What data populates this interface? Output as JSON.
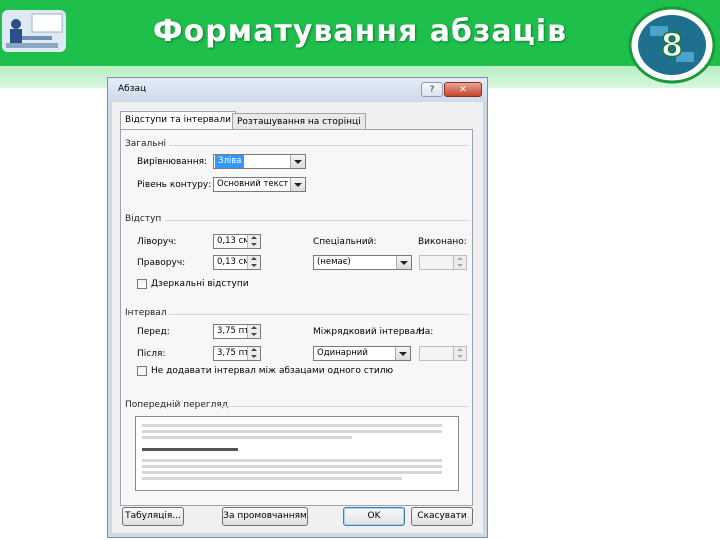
{
  "slide": {
    "title": "Форматування абзаців",
    "badge_number": "8"
  },
  "dialog": {
    "title": "Абзац",
    "help_label": "?",
    "close_label": "✕",
    "tabs": [
      {
        "label": "Відступи та інтервали",
        "active": true
      },
      {
        "label": "Розташування на сторінці",
        "active": false
      }
    ],
    "general": {
      "heading": "Загальні",
      "alignment_label": "Вирівнювання:",
      "alignment_value": "Зліва",
      "outline_label": "Рівень контуру:",
      "outline_value": "Основний текст"
    },
    "indent": {
      "heading": "Відступ",
      "left_label": "Ліворуч:",
      "left_value": "0,13 см",
      "right_label": "Праворуч:",
      "right_value": "0,13 см",
      "special_label": "Спеціальний:",
      "special_value": "(немає)",
      "by_label": "Виконано:",
      "by_value": "",
      "mirror_label": "Дзеркальні відступи"
    },
    "spacing": {
      "heading": "Інтервал",
      "before_label": "Перед:",
      "before_value": "3,75 пт",
      "after_label": "Після:",
      "after_value": "3,75 пт",
      "line_label": "Міжрядковий інтервал:",
      "line_value": "Одинарний",
      "at_label": "На:",
      "at_value": "",
      "no_space_label": "Не додавати інтервал між абзацами одного стилю"
    },
    "preview": {
      "heading": "Попередній перегляд"
    },
    "buttons": {
      "tabs": "Табуляція...",
      "default": "За промовчанням",
      "ok": "OK",
      "cancel": "Скасувати"
    }
  },
  "colors": {
    "banner": "#1fbf4c",
    "selection": "#3399ff"
  }
}
